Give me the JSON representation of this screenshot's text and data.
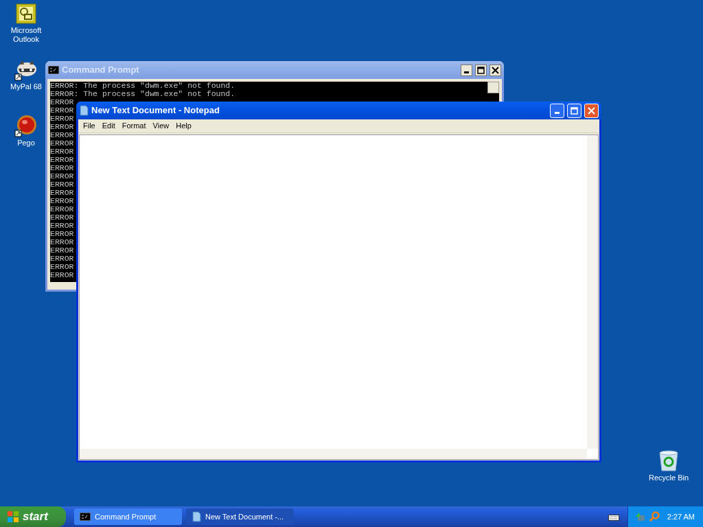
{
  "desktop_icons": [
    {
      "label": "Microsoft Outlook",
      "kind": "outlook"
    },
    {
      "label": "MyPal 68",
      "kind": "mypal"
    },
    {
      "label": "Pego",
      "kind": "pego"
    },
    {
      "label": "Recycle Bin",
      "kind": "recycle"
    }
  ],
  "command_prompt": {
    "title": "Command Prompt",
    "active": false,
    "lines": [
      "ERROR: The process \"dwm.exe\" not found.",
      "ERROR: The process \"dwm.exe\" not found.",
      "ERROR",
      "ERROR",
      "ERROR",
      "ERROR",
      "ERROR",
      "ERROR",
      "ERROR",
      "ERROR",
      "ERROR",
      "ERROR",
      "ERROR",
      "ERROR",
      "ERROR",
      "ERROR",
      "ERROR",
      "ERROR",
      "ERROR",
      "ERROR",
      "ERROR",
      "ERROR",
      "ERROR",
      "ERROR"
    ]
  },
  "notepad": {
    "title": "New Text Document - Notepad",
    "active": true,
    "menu": [
      "File",
      "Edit",
      "Format",
      "View",
      "Help"
    ]
  },
  "taskbar": {
    "start": "start",
    "tasks": [
      {
        "label": "Command Prompt",
        "kind": "console",
        "selected": false
      },
      {
        "label": "New Text Document -...",
        "kind": "notepad",
        "selected": true
      }
    ],
    "clock": "2:27 AM"
  }
}
